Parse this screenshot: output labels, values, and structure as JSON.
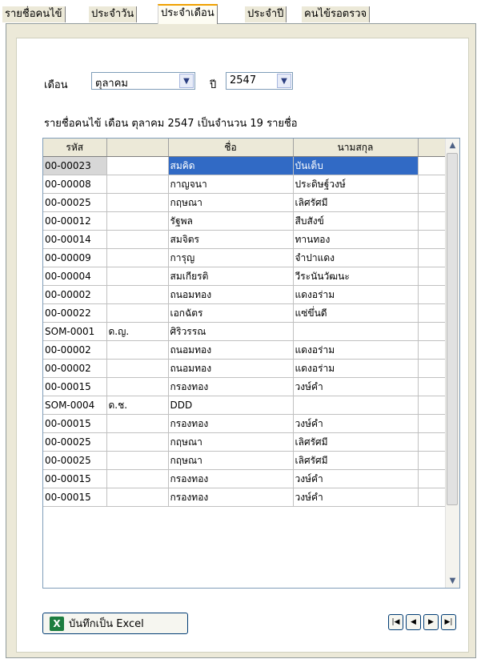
{
  "tabs": [
    {
      "label": "รายชื่อคนไข้"
    },
    {
      "label": "ประจำวัน"
    },
    {
      "label": "ประจำเดือน",
      "active": true
    },
    {
      "label": "ประจำปี"
    },
    {
      "label": "คนไข้รอตรวจ"
    }
  ],
  "filter": {
    "month_label": "เดือน",
    "month_value": "ตุลาคม",
    "year_label": "ปี",
    "year_value": "2547"
  },
  "summary": "รายชื่อคนไข้ เดือน ตุลาคม 2547 เป็นจำนวน 19 รายชื่อ",
  "grid": {
    "columns": [
      "รหัส",
      "",
      "ชื่อ",
      "นามสกุล"
    ],
    "selected_row": 0,
    "rows": [
      [
        "00-00023",
        "",
        "สมคิด",
        "บันเต็บ"
      ],
      [
        "00-00008",
        "",
        "กาญจนา",
        "ประดิษฐ์วงษ์"
      ],
      [
        "00-00025",
        "",
        "กฤษณา",
        "เลิศรัศมี"
      ],
      [
        "00-00012",
        "",
        "รัฐพล",
        "สืบสังข์"
      ],
      [
        "00-00014",
        "",
        "สมจิตร",
        "ทานทอง"
      ],
      [
        "00-00009",
        "",
        "การุญ",
        "จำปาแดง"
      ],
      [
        "00-00004",
        "",
        "สมเกียรติ",
        "วีระนันวัฒนะ"
      ],
      [
        "00-00002",
        "",
        "ถนอมทอง",
        "แดงอร่าม"
      ],
      [
        "00-00022",
        "",
        "เอกฉัตร",
        "แซ่ขึ่นดี"
      ],
      [
        "SOM-0001",
        "ด.ญ.",
        "ศิริวรรณ",
        ""
      ],
      [
        "00-00002",
        "",
        "ถนอมทอง",
        "แดงอร่าม"
      ],
      [
        "00-00002",
        "",
        "ถนอมทอง",
        "แดงอร่าม"
      ],
      [
        "00-00015",
        "",
        "กรองทอง",
        "วงษ์คำ"
      ],
      [
        "SOM-0004",
        "ด.ช.",
        "DDD",
        ""
      ],
      [
        "00-00015",
        "",
        "กรองทอง",
        "วงษ์คำ"
      ],
      [
        "00-00025",
        "",
        "กฤษณา",
        "เลิศรัศมี"
      ],
      [
        "00-00025",
        "",
        "กฤษณา",
        "เลิศรัศมี"
      ],
      [
        "00-00015",
        "",
        "กรองทอง",
        "วงษ์คำ"
      ],
      [
        "00-00015",
        "",
        "กรองทอง",
        "วงษ์คำ"
      ]
    ]
  },
  "buttons": {
    "export_excel": "บันทึกเป็น Excel",
    "nav_first": "first-record-icon",
    "nav_prev": "prev-record-icon",
    "nav_next": "next-record-icon",
    "nav_last": "last-record-icon"
  }
}
